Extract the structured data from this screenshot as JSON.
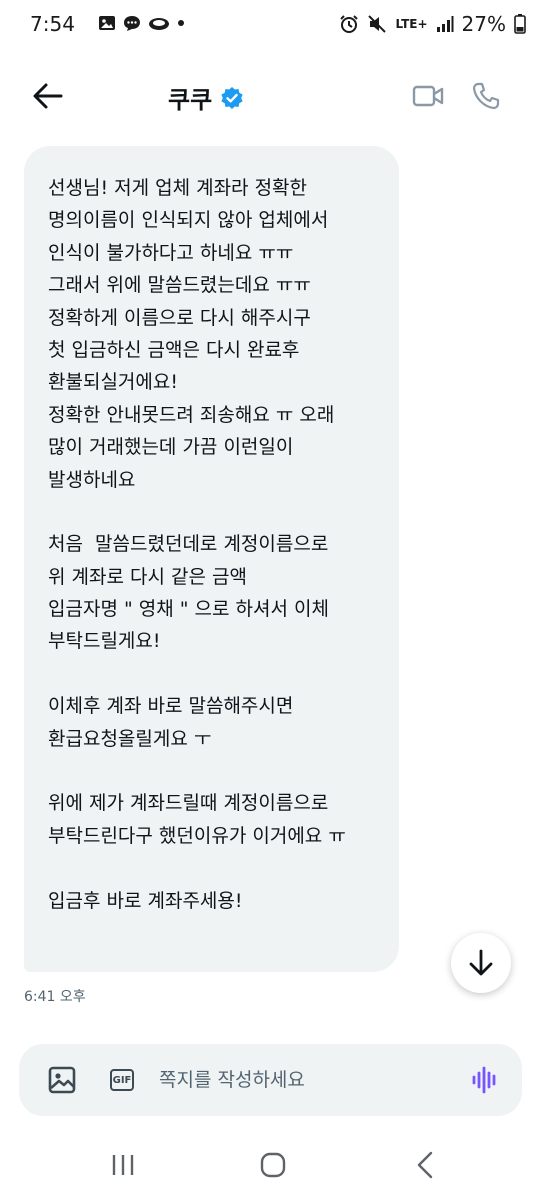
{
  "status_bar": {
    "time": "7:54",
    "network": "LTE+",
    "battery": "27%",
    "icons_left": [
      "gallery-icon",
      "chat-icon",
      "cloud-icon",
      "dot-icon"
    ],
    "icons_right": [
      "alarm-icon",
      "mute-icon",
      "signal-icon",
      "battery-icon"
    ]
  },
  "header": {
    "title": "쿠쿠",
    "verified": true,
    "icons": [
      "back-arrow-icon",
      "verified-badge-icon",
      "video-call-icon",
      "phone-icon"
    ]
  },
  "message": {
    "lines": [
      "선생님! 저게 업체 계좌라 정확한",
      "명의이름이 인식되지 않아 업체에서",
      "인식이 불가하다고 하네요 ㅠㅠ",
      "그래서 위에 말씀드렸는데요 ㅠㅠ",
      "정확하게 이름으로 다시 해주시구",
      "첫 입금하신 금액은 다시 완료후",
      "환불되실거에요!",
      "정확한 안내못드려 죄송해요 ㅠ 오래",
      "많이 거래했는데 가끔 이런일이",
      "발생하네요",
      "",
      "처음  말씀드렸던데로 계정이름으로",
      "위 계좌로 다시 같은 금액",
      "입금자명 \" 영채 \" 으로 하셔서 이체",
      "부탁드릴게요!",
      "",
      "이체후 계좌 바로 말씀해주시면",
      "환급요청올릴게요 ㅜ",
      "",
      "위에 제가 계좌드릴때 계정이름으로",
      "부탁드린다구 했던이유가 이거에요 ㅠ",
      "",
      "입금후 바로 계좌주세용!"
    ],
    "timestamp": "6:41 오후"
  },
  "composer": {
    "placeholder": "쪽지를 작성하세요",
    "gif_label": "GIF",
    "icons": [
      "image-icon",
      "gif-icon",
      "voice-wave-icon"
    ]
  },
  "scroll_button": {
    "icon": "arrow-down-icon"
  },
  "nav_bar": {
    "icons": [
      "recent-apps-icon",
      "home-icon",
      "nav-back-icon"
    ]
  },
  "colors": {
    "bubble": "#eff3f4",
    "verified": "#1d9bf0",
    "voice": "#7856ff",
    "muted_text": "#536471"
  }
}
